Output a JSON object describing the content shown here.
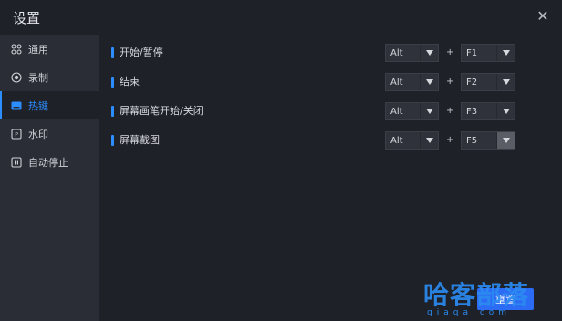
{
  "window": {
    "title": "设置",
    "close_glyph": "✕"
  },
  "sidebar": {
    "items": [
      {
        "label": "通用",
        "icon": "grid-icon",
        "active": false
      },
      {
        "label": "录制",
        "icon": "record-icon",
        "active": false
      },
      {
        "label": "热键",
        "icon": "keyboard-icon",
        "active": true
      },
      {
        "label": "水印",
        "icon": "watermark-icon",
        "active": false
      },
      {
        "label": "自动停止",
        "icon": "auto-stop-icon",
        "active": false
      }
    ]
  },
  "hotkeys": [
    {
      "label": "开始/暂停",
      "modifier": "Alt",
      "plus": "+",
      "key": "F1",
      "key_highlighted": false
    },
    {
      "label": "结束",
      "modifier": "Alt",
      "plus": "+",
      "key": "F2",
      "key_highlighted": false
    },
    {
      "label": "屏幕画笔开始/关闭",
      "modifier": "Alt",
      "plus": "+",
      "key": "F3",
      "key_highlighted": false
    },
    {
      "label": "屏幕截图",
      "modifier": "Alt",
      "plus": "+",
      "key": "F5",
      "key_highlighted": true
    }
  ],
  "footer": {
    "reset_label": "重置"
  },
  "watermark": {
    "text": "哈客部落",
    "sub": "qiaqa.com"
  },
  "colors": {
    "accent": "#2c8dff",
    "button": "#2c6cf5",
    "background": "#1f2128",
    "sidebar": "#2a2d35"
  }
}
